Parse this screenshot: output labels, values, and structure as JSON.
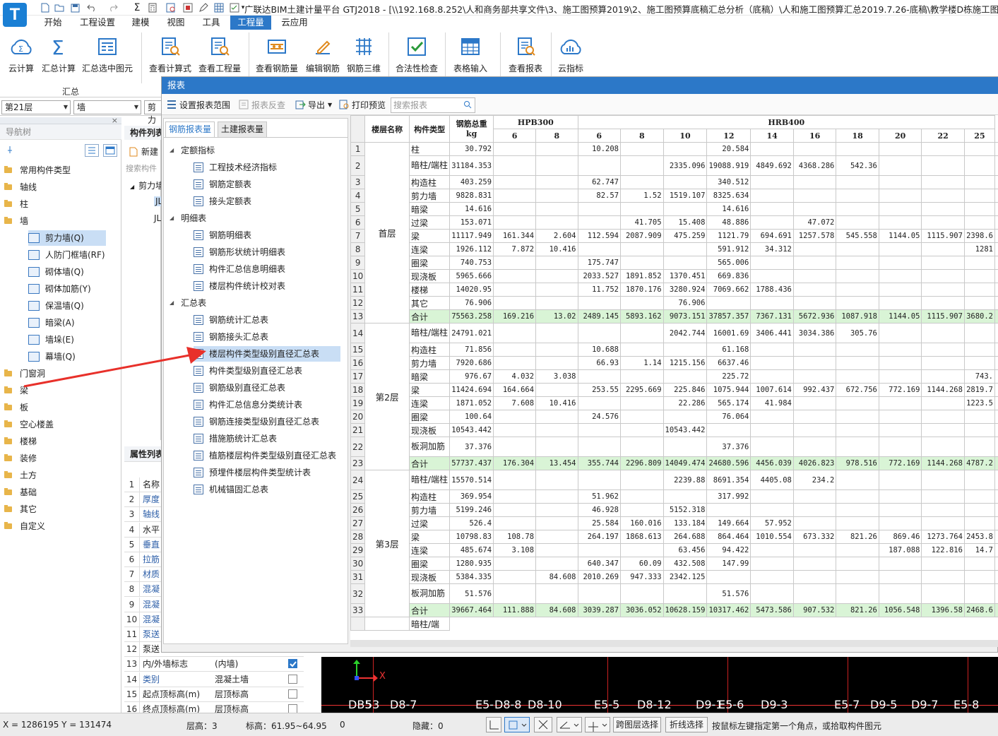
{
  "app": {
    "logo": "T",
    "title": "广联达BIM土建计量平台 GTJ2018 - [\\\\192.168.8.252\\人和商务部共享文件\\3、施工图预算2019\\2、施工图预算底稿汇总分析（底稿）\\人和施工图预算汇总2019.7.26-底稿\\教学楼D栋施工图预算-黎"
  },
  "menu": [
    "开始",
    "工程设置",
    "建模",
    "视图",
    "工具",
    "工程量",
    "云应用"
  ],
  "ribbon": {
    "buttons": [
      "云计算",
      "汇总计算",
      "汇总选中图元",
      "查看计算式",
      "查看工程量",
      "查看钢筋量",
      "编辑钢筋",
      "钢筋三维",
      "合法性检查",
      "表格输入",
      "查看报表",
      "云指标"
    ],
    "group_label": "汇总"
  },
  "selectors": {
    "floor": "第21层",
    "type": "墙",
    "third": "剪力"
  },
  "nav": {
    "title": "导航树",
    "items": [
      {
        "label": "常用构件类型",
        "level": 0
      },
      {
        "label": "轴线",
        "level": 0
      },
      {
        "label": "柱",
        "level": 0
      },
      {
        "label": "墙",
        "level": 0
      },
      {
        "label": "剪力墙(Q)",
        "level": 1,
        "selected": true
      },
      {
        "label": "人防门框墙(RF)",
        "level": 1
      },
      {
        "label": "砌体墙(Q)",
        "level": 1
      },
      {
        "label": "砌体加筋(Y)",
        "level": 1
      },
      {
        "label": "保温墙(Q)",
        "level": 1
      },
      {
        "label": "暗梁(A)",
        "level": 1
      },
      {
        "label": "墙垛(E)",
        "level": 1
      },
      {
        "label": "幕墙(Q)",
        "level": 1
      },
      {
        "label": "门窗洞",
        "level": 0
      },
      {
        "label": "梁",
        "level": 0
      },
      {
        "label": "板",
        "level": 0
      },
      {
        "label": "空心楼盖",
        "level": 0
      },
      {
        "label": "楼梯",
        "level": 0
      },
      {
        "label": "装修",
        "level": 0
      },
      {
        "label": "土方",
        "level": 0
      },
      {
        "label": "基础",
        "level": 0
      },
      {
        "label": "其它",
        "level": 0
      },
      {
        "label": "自定义",
        "level": 0
      }
    ]
  },
  "complist": {
    "title": "构件列表",
    "new_label": "新建",
    "search_placeholder": "搜索构件",
    "group": "剪力墙",
    "items": [
      "JL",
      "JL"
    ]
  },
  "props": {
    "title": "属性列表",
    "rows": [
      {
        "n": "1",
        "k": "名称",
        "v": ""
      },
      {
        "n": "2",
        "k": "厚度",
        "v": ""
      },
      {
        "n": "3",
        "k": "轴线",
        "v": ""
      },
      {
        "n": "4",
        "k": "水平",
        "v": ""
      },
      {
        "n": "5",
        "k": "垂直",
        "v": ""
      },
      {
        "n": "6",
        "k": "拉筋",
        "v": ""
      },
      {
        "n": "7",
        "k": "材质",
        "v": ""
      },
      {
        "n": "8",
        "k": "混凝",
        "v": ""
      },
      {
        "n": "9",
        "k": "混凝",
        "v": ""
      },
      {
        "n": "10",
        "k": "混凝",
        "v": ""
      },
      {
        "n": "11",
        "k": "泵送",
        "v": ""
      },
      {
        "n": "12",
        "k": "泵送",
        "v": ""
      },
      {
        "n": "13",
        "k": "内/外墙标志",
        "v": "(内墙)",
        "check": true
      },
      {
        "n": "14",
        "k": "类别",
        "v": "混凝土墙",
        "check": false
      },
      {
        "n": "15",
        "k": "起点顶标高(m)",
        "v": "层顶标高",
        "check": false
      },
      {
        "n": "16",
        "k": "终点顶标高(m)",
        "v": "层顶标高",
        "check": false
      }
    ]
  },
  "dialog": {
    "title": "报表",
    "toolbar": {
      "range": "设置报表范围",
      "reverse": "报表反查",
      "export": "导出",
      "preview": "打印预览",
      "search_placeholder": "搜索报表"
    },
    "tabs": [
      "钢筋报表量",
      "土建报表量"
    ],
    "tree": [
      {
        "label": "定额指标",
        "kind": "group"
      },
      {
        "label": "工程技术经济指标",
        "kind": "leaf"
      },
      {
        "label": "钢筋定额表",
        "kind": "leaf"
      },
      {
        "label": "接头定额表",
        "kind": "leaf"
      },
      {
        "label": "明细表",
        "kind": "group"
      },
      {
        "label": "钢筋明细表",
        "kind": "leaf"
      },
      {
        "label": "钢筋形状统计明细表",
        "kind": "leaf"
      },
      {
        "label": "构件汇总信息明细表",
        "kind": "leaf"
      },
      {
        "label": "楼层构件统计校对表",
        "kind": "leaf"
      },
      {
        "label": "汇总表",
        "kind": "group"
      },
      {
        "label": "钢筋统计汇总表",
        "kind": "leaf"
      },
      {
        "label": "钢筋接头汇总表",
        "kind": "leaf"
      },
      {
        "label": "楼层构件类型级别直径汇总表",
        "kind": "leaf",
        "selected": true
      },
      {
        "label": "构件类型级别直径汇总表",
        "kind": "leaf"
      },
      {
        "label": "钢筋级别直径汇总表",
        "kind": "leaf"
      },
      {
        "label": "构件汇总信息分类统计表",
        "kind": "leaf"
      },
      {
        "label": "钢筋连接类型级别直径汇总表",
        "kind": "leaf"
      },
      {
        "label": "措施筋统计汇总表",
        "kind": "leaf"
      },
      {
        "label": "植筋楼层构件类型级别直径汇总表",
        "kind": "leaf"
      },
      {
        "label": "预埋件楼层构件类型统计表",
        "kind": "leaf"
      },
      {
        "label": "机械锚固汇总表",
        "kind": "leaf"
      }
    ]
  },
  "table": {
    "h_floor": "楼层名称",
    "h_type": "构件类型",
    "h_total": "钢筋总重kg",
    "h_group1": "HPB300",
    "h_group2": "HRB400",
    "diams": [
      "6",
      "8",
      "6",
      "8",
      "10",
      "12",
      "14",
      "16",
      "18",
      "20",
      "22",
      "25"
    ],
    "floors": [
      {
        "name": "首层",
        "rows": [
          [
            "1",
            "柱",
            "30.792",
            "",
            "",
            "10.208",
            "",
            "",
            "20.584",
            "",
            "",
            "",
            "",
            "",
            ""
          ],
          [
            "2",
            "暗柱/端柱",
            "31184.353",
            "",
            "",
            "",
            "",
            "2335.096",
            "19088.919",
            "4849.692",
            "4368.286",
            "542.36",
            "",
            "",
            ""
          ],
          [
            "3",
            "构造柱",
            "403.259",
            "",
            "",
            "62.747",
            "",
            "",
            "340.512",
            "",
            "",
            "",
            "",
            "",
            ""
          ],
          [
            "4",
            "剪力墙",
            "9828.831",
            "",
            "",
            "82.57",
            "1.52",
            "1519.107",
            "8325.634",
            "",
            "",
            "",
            "",
            "",
            ""
          ],
          [
            "5",
            "暗梁",
            "14.616",
            "",
            "",
            "",
            "",
            "",
            "14.616",
            "",
            "",
            "",
            "",
            "",
            ""
          ],
          [
            "6",
            "过梁",
            "153.071",
            "",
            "",
            "",
            "41.705",
            "15.408",
            "48.886",
            "",
            "47.072",
            "",
            "",
            "",
            ""
          ],
          [
            "7",
            "梁",
            "11117.949",
            "161.344",
            "2.604",
            "112.594",
            "2087.909",
            "475.259",
            "1121.79",
            "694.691",
            "1257.578",
            "545.558",
            "1144.05",
            "1115.907",
            "2398.6"
          ],
          [
            "8",
            "连梁",
            "1926.112",
            "7.872",
            "10.416",
            "",
            "",
            "",
            "591.912",
            "34.312",
            "",
            "",
            "",
            "",
            "1281"
          ],
          [
            "9",
            "圈梁",
            "740.753",
            "",
            "",
            "175.747",
            "",
            "",
            "565.006",
            "",
            "",
            "",
            "",
            "",
            ""
          ],
          [
            "10",
            "现浇板",
            "5965.666",
            "",
            "",
            "2033.527",
            "1891.852",
            "1370.451",
            "669.836",
            "",
            "",
            "",
            "",
            "",
            ""
          ],
          [
            "11",
            "楼梯",
            "14020.95",
            "",
            "",
            "11.752",
            "1870.176",
            "3280.924",
            "7069.662",
            "1788.436",
            "",
            "",
            "",
            "",
            ""
          ],
          [
            "12",
            "其它",
            "76.906",
            "",
            "",
            "",
            "",
            "76.906",
            "",
            "",
            "",
            "",
            "",
            "",
            ""
          ],
          [
            "13",
            "合计",
            "75563.258",
            "169.216",
            "13.02",
            "2489.145",
            "5893.162",
            "9073.151",
            "37857.357",
            "7367.131",
            "5672.936",
            "1087.918",
            "1144.05",
            "1115.907",
            "3680.2"
          ]
        ]
      },
      {
        "name": "第2层",
        "rows": [
          [
            "14",
            "暗柱/端柱",
            "24791.021",
            "",
            "",
            "",
            "",
            "2042.744",
            "16001.69",
            "3406.441",
            "3034.386",
            "305.76",
            "",
            "",
            ""
          ],
          [
            "15",
            "构造柱",
            "71.856",
            "",
            "",
            "10.688",
            "",
            "",
            "61.168",
            "",
            "",
            "",
            "",
            "",
            ""
          ],
          [
            "16",
            "剪力墙",
            "7920.686",
            "",
            "",
            "66.93",
            "1.14",
            "1215.156",
            "6637.46",
            "",
            "",
            "",
            "",
            "",
            ""
          ],
          [
            "17",
            "暗梁",
            "976.67",
            "4.032",
            "3.038",
            "",
            "",
            "",
            "225.72",
            "",
            "",
            "",
            "",
            "",
            "743."
          ],
          [
            "18",
            "梁",
            "11424.694",
            "164.664",
            "",
            "253.55",
            "2295.669",
            "225.846",
            "1075.944",
            "1007.614",
            "992.437",
            "672.756",
            "772.169",
            "1144.268",
            "2819.7"
          ],
          [
            "19",
            "连梁",
            "1871.052",
            "7.608",
            "10.416",
            "",
            "",
            "22.286",
            "565.174",
            "41.984",
            "",
            "",
            "",
            "",
            "1223.5"
          ],
          [
            "20",
            "圈梁",
            "100.64",
            "",
            "",
            "24.576",
            "",
            "",
            "76.064",
            "",
            "",
            "",
            "",
            "",
            ""
          ],
          [
            "21",
            "现浇板",
            "10543.442",
            "",
            "",
            "",
            "",
            "10543.442",
            "",
            "",
            "",
            "",
            "",
            "",
            ""
          ],
          [
            "22",
            "板洞加筋",
            "37.376",
            "",
            "",
            "",
            "",
            "",
            "37.376",
            "",
            "",
            "",
            "",
            "",
            ""
          ],
          [
            "23",
            "合计",
            "57737.437",
            "176.304",
            "13.454",
            "355.744",
            "2296.809",
            "14049.474",
            "24680.596",
            "4456.039",
            "4026.823",
            "978.516",
            "772.169",
            "1144.268",
            "4787.2"
          ]
        ]
      },
      {
        "name": "第3层",
        "rows": [
          [
            "24",
            "暗柱/端柱",
            "15570.514",
            "",
            "",
            "",
            "",
            "2239.88",
            "8691.354",
            "4405.08",
            "234.2",
            "",
            "",
            "",
            ""
          ],
          [
            "25",
            "构造柱",
            "369.954",
            "",
            "",
            "51.962",
            "",
            "",
            "317.992",
            "",
            "",
            "",
            "",
            "",
            ""
          ],
          [
            "26",
            "剪力墙",
            "5199.246",
            "",
            "",
            "46.928",
            "",
            "5152.318",
            "",
            "",
            "",
            "",
            "",
            "",
            ""
          ],
          [
            "27",
            "过梁",
            "526.4",
            "",
            "",
            "25.584",
            "160.016",
            "133.184",
            "149.664",
            "57.952",
            "",
            "",
            "",
            "",
            ""
          ],
          [
            "28",
            "梁",
            "10798.83",
            "108.78",
            "",
            "264.197",
            "1868.613",
            "264.688",
            "864.464",
            "1010.554",
            "673.332",
            "821.26",
            "869.46",
            "1273.764",
            "2453.8"
          ],
          [
            "29",
            "连梁",
            "485.674",
            "3.108",
            "",
            "",
            "",
            "63.456",
            "94.422",
            "",
            "",
            "",
            "187.088",
            "122.816",
            "14.7"
          ],
          [
            "30",
            "圈梁",
            "1280.935",
            "",
            "",
            "640.347",
            "60.09",
            "432.508",
            "147.99",
            "",
            "",
            "",
            "",
            "",
            ""
          ],
          [
            "31",
            "现浇板",
            "5384.335",
            "",
            "84.608",
            "2010.269",
            "947.333",
            "2342.125",
            "",
            "",
            "",
            "",
            "",
            "",
            ""
          ],
          [
            "32",
            "板洞加筋",
            "51.576",
            "",
            "",
            "",
            "",
            "",
            "51.576",
            "",
            "",
            "",
            "",
            "",
            ""
          ],
          [
            "33",
            "合计",
            "39667.464",
            "111.888",
            "84.608",
            "3039.287",
            "3036.052",
            "10628.159",
            "10317.462",
            "5473.586",
            "907.532",
            "821.26",
            "1056.548",
            "1396.58",
            "2468.6"
          ]
        ]
      }
    ],
    "tail_row": "暗柱/端"
  },
  "cad": {
    "axis_label": "X",
    "labels": [
      "DB5",
      "53",
      "D8-7",
      "E5-",
      "D8-8",
      "D8-10",
      "E5-5",
      "D8-12",
      "D9-1",
      "E5-6",
      "D9-3",
      "E5-7",
      "D9-5",
      "D9-7",
      "E5-8"
    ]
  },
  "status": {
    "coords": "X = 1286195 Y = 131474",
    "floor_h": "层高：3",
    "elev": "标高：61.95~64.95",
    "zero": "0",
    "hidden": "隐藏：0",
    "cross": "跨图层选择",
    "polyline": "折线选择",
    "hint": "按鼠标左键指定第一个角点，或拾取构件图元"
  },
  "colors": {
    "accent": "#2c78c8",
    "sum_row": "#d9f4d6",
    "selected": "#c9def5",
    "arrow": "#e8302a"
  }
}
